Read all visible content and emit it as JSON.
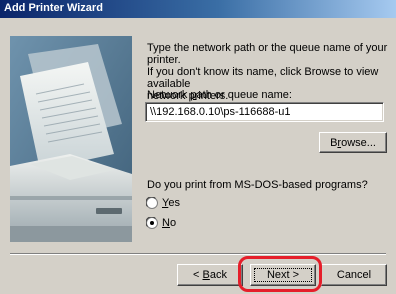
{
  "window": {
    "title": "Add Printer Wizard"
  },
  "intro": {
    "line1": "Type the network path or the queue name of your printer.",
    "line2": "If you don't know its name, click Browse to view available",
    "line3": "network printers."
  },
  "path_field": {
    "label_prefix": "Network ",
    "label_accel": "p",
    "label_suffix": "ath or queue name:",
    "value": "\\\\192.168.0.10\\ps-116688-u1"
  },
  "buttons": {
    "browse_prefix": "B",
    "browse_accel": "r",
    "browse_suffix": "owse...",
    "back_prefix": "< ",
    "back_accel": "B",
    "back_suffix": "ack",
    "next": "Next >",
    "cancel": "Cancel"
  },
  "msdos": {
    "question": "Do you print from MS-DOS-based programs?",
    "options": [
      {
        "accel": "Y",
        "rest": "es",
        "selected": false
      },
      {
        "accel": "N",
        "rest": "o",
        "selected": true
      }
    ]
  },
  "colors": {
    "titlebar_start": "#0a246a",
    "titlebar_end": "#a6caf0",
    "dialog_bg": "#d4d0c8",
    "highlight": "#e51e2a"
  },
  "illustration": {
    "icon": "printer-with-paper-illustration"
  }
}
